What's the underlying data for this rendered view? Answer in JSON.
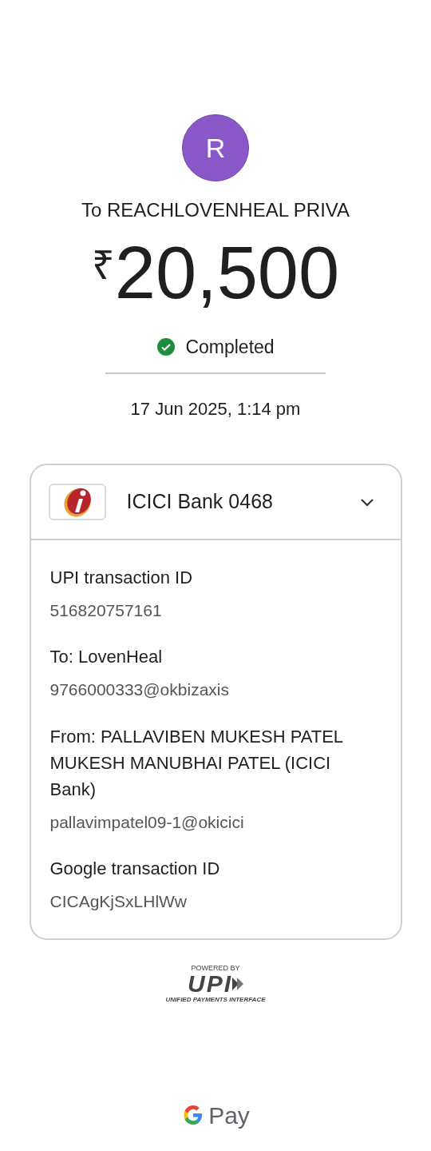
{
  "payee": {
    "initial": "R",
    "title": "To REACHLOVENHEAL PRIVA"
  },
  "amount": {
    "currency": "₹",
    "value": "20,500"
  },
  "status": {
    "label": "Completed",
    "completed": true
  },
  "date": "17 Jun 2025, 1:14 pm",
  "card": {
    "bank": "ICICI Bank 0468",
    "expanded": true,
    "details": [
      {
        "label": "UPI transaction ID",
        "value": "516820757161"
      },
      {
        "label": "To: LovenHeal",
        "value": "9766000333@okbizaxis"
      },
      {
        "label": "From: PALLAVIBEN MUKESH PATEL MUKESH MANUBHAI PATEL (ICICI Bank)",
        "value": "pallavimpatel09-1@okicici"
      },
      {
        "label": "Google transaction ID",
        "value": "CICAgKjSxLHlWw"
      }
    ]
  },
  "upi_logo": {
    "tagline": "POWERED BY",
    "mark": "UPI",
    "subtitle": "UNIFIED PAYMENTS INTERFACE"
  },
  "gpay": {
    "label": "Pay"
  }
}
